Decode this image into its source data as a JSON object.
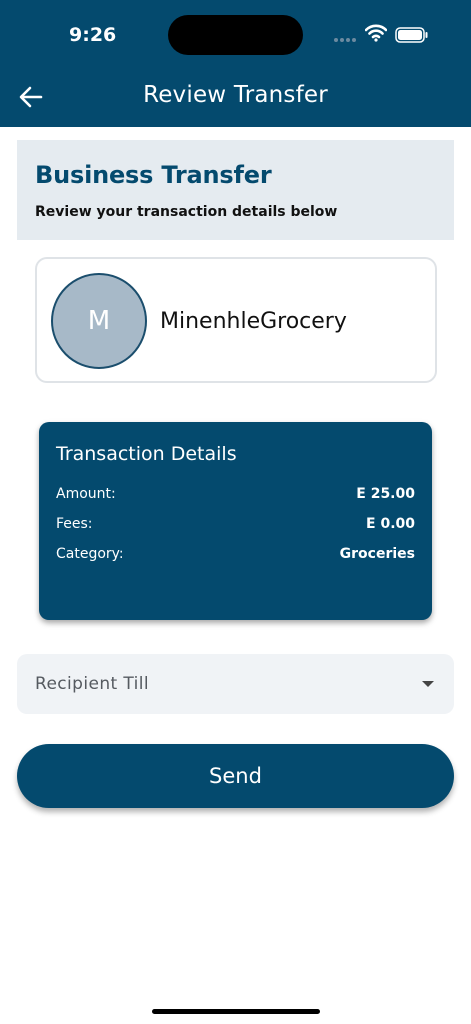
{
  "status_bar": {
    "time": "9:26"
  },
  "header": {
    "title": "Review Transfer"
  },
  "banner": {
    "title": "Business Transfer",
    "subtitle": "Review your transaction details below"
  },
  "recipient": {
    "avatar_initial": "M",
    "name": "MinenhleGrocery"
  },
  "details": {
    "title": "Transaction Details",
    "rows": [
      {
        "label": "Amount:",
        "value": "E 25.00"
      },
      {
        "label": "Fees:",
        "value": "E 0.00"
      },
      {
        "label": "Category:",
        "value": "Groceries"
      }
    ]
  },
  "till_select": {
    "placeholder": "Recipient Till"
  },
  "send_button": {
    "label": "Send"
  },
  "colors": {
    "primary": "#044a6e",
    "banner_bg": "#e5ebf0",
    "avatar_bg": "#a7b9c8",
    "input_bg": "#f0f3f6"
  },
  "icons": {
    "back": "arrow-left-icon",
    "wifi": "wifi-icon",
    "battery": "battery-icon",
    "dropdown": "caret-down-icon"
  }
}
